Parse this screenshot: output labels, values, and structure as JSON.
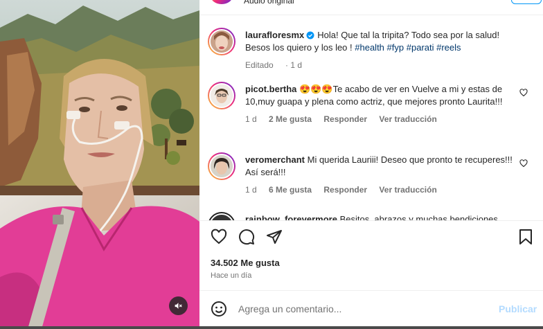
{
  "header": {
    "audio_label": "Audio original"
  },
  "post": {
    "author": "laurafloresmx",
    "caption": "Hola! Que tal la tripita? Todo sea por la salud! Besos los quiero y los leo !",
    "hashtags": [
      "#health",
      "#fyp",
      "#parati",
      "#reels"
    ],
    "edited_label": "Editado",
    "edited_time": "1 d"
  },
  "comments": [
    {
      "username": "picot.bertha",
      "text": "😍😍😍Te acabo de ver en Vuelve a mi y estas de 10,muy guapa y plena como actriz, que mejores pronto Laurita!!!",
      "time": "1 d",
      "likes": "2 Me gusta",
      "reply": "Responder",
      "translate": "Ver traducción"
    },
    {
      "username": "veromerchant",
      "text": "Mi querida Lauriii! Deseo que pronto te recuperes!!! Así será!!!",
      "time": "1 d",
      "likes": "6 Me gusta",
      "reply": "Responder",
      "translate": "Ver traducción"
    },
    {
      "username": "rainbow_forevermore",
      "text": "Besitos, abrazos y muchas bendiciones"
    }
  ],
  "stats": {
    "likes_label": "34.502 Me gusta",
    "posted_ago": "Hace un día"
  },
  "composer": {
    "placeholder": "Agrega un comentario...",
    "publish_label": "Publicar"
  },
  "colors": {
    "hashtag": "#00376b",
    "secondary_text": "#737373",
    "publish_disabled": "#b3dbff",
    "verified": "#0095f6"
  },
  "icons": {
    "mute": "speaker-muted-icon",
    "like": "heart-icon",
    "comment": "comment-bubble-icon",
    "share": "paper-plane-icon",
    "save": "bookmark-icon",
    "emoji": "smiley-icon",
    "verified": "verified-badge-icon"
  }
}
